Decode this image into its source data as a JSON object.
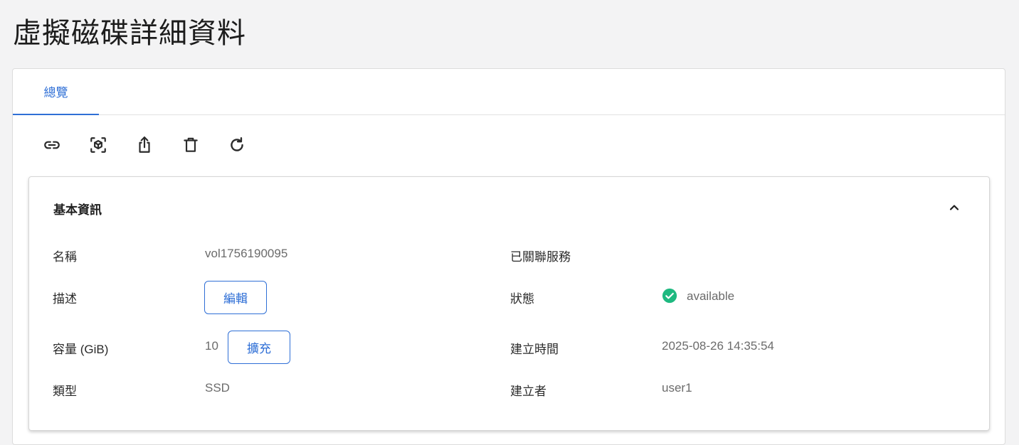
{
  "page": {
    "title": "虛擬磁碟詳細資料"
  },
  "tabs": [
    {
      "label": "總覽",
      "active": true
    }
  ],
  "toolbar": {
    "icons": [
      "link-icon",
      "cube-scan-icon",
      "share-icon",
      "trash-icon",
      "refresh-icon"
    ]
  },
  "basic_info": {
    "title": "基本資訊",
    "name_label": "名稱",
    "name_value": "vol1756190095",
    "description_label": "描述",
    "edit_button": "編輯",
    "capacity_label": "容量 (GiB)",
    "capacity_value": "10",
    "expand_button": "擴充",
    "type_label": "類型",
    "type_value": "SSD",
    "attached_service_label": "已關聯服務",
    "status_label": "狀態",
    "status_value": "available",
    "created_time_label": "建立時間",
    "created_time_value": "2025-08-26 14:35:54",
    "creator_label": "建立者",
    "creator_value": "user1"
  },
  "colors": {
    "accent": "#2f6fd6",
    "status_ok": "#1eb980",
    "background": "#f3f3f4"
  }
}
